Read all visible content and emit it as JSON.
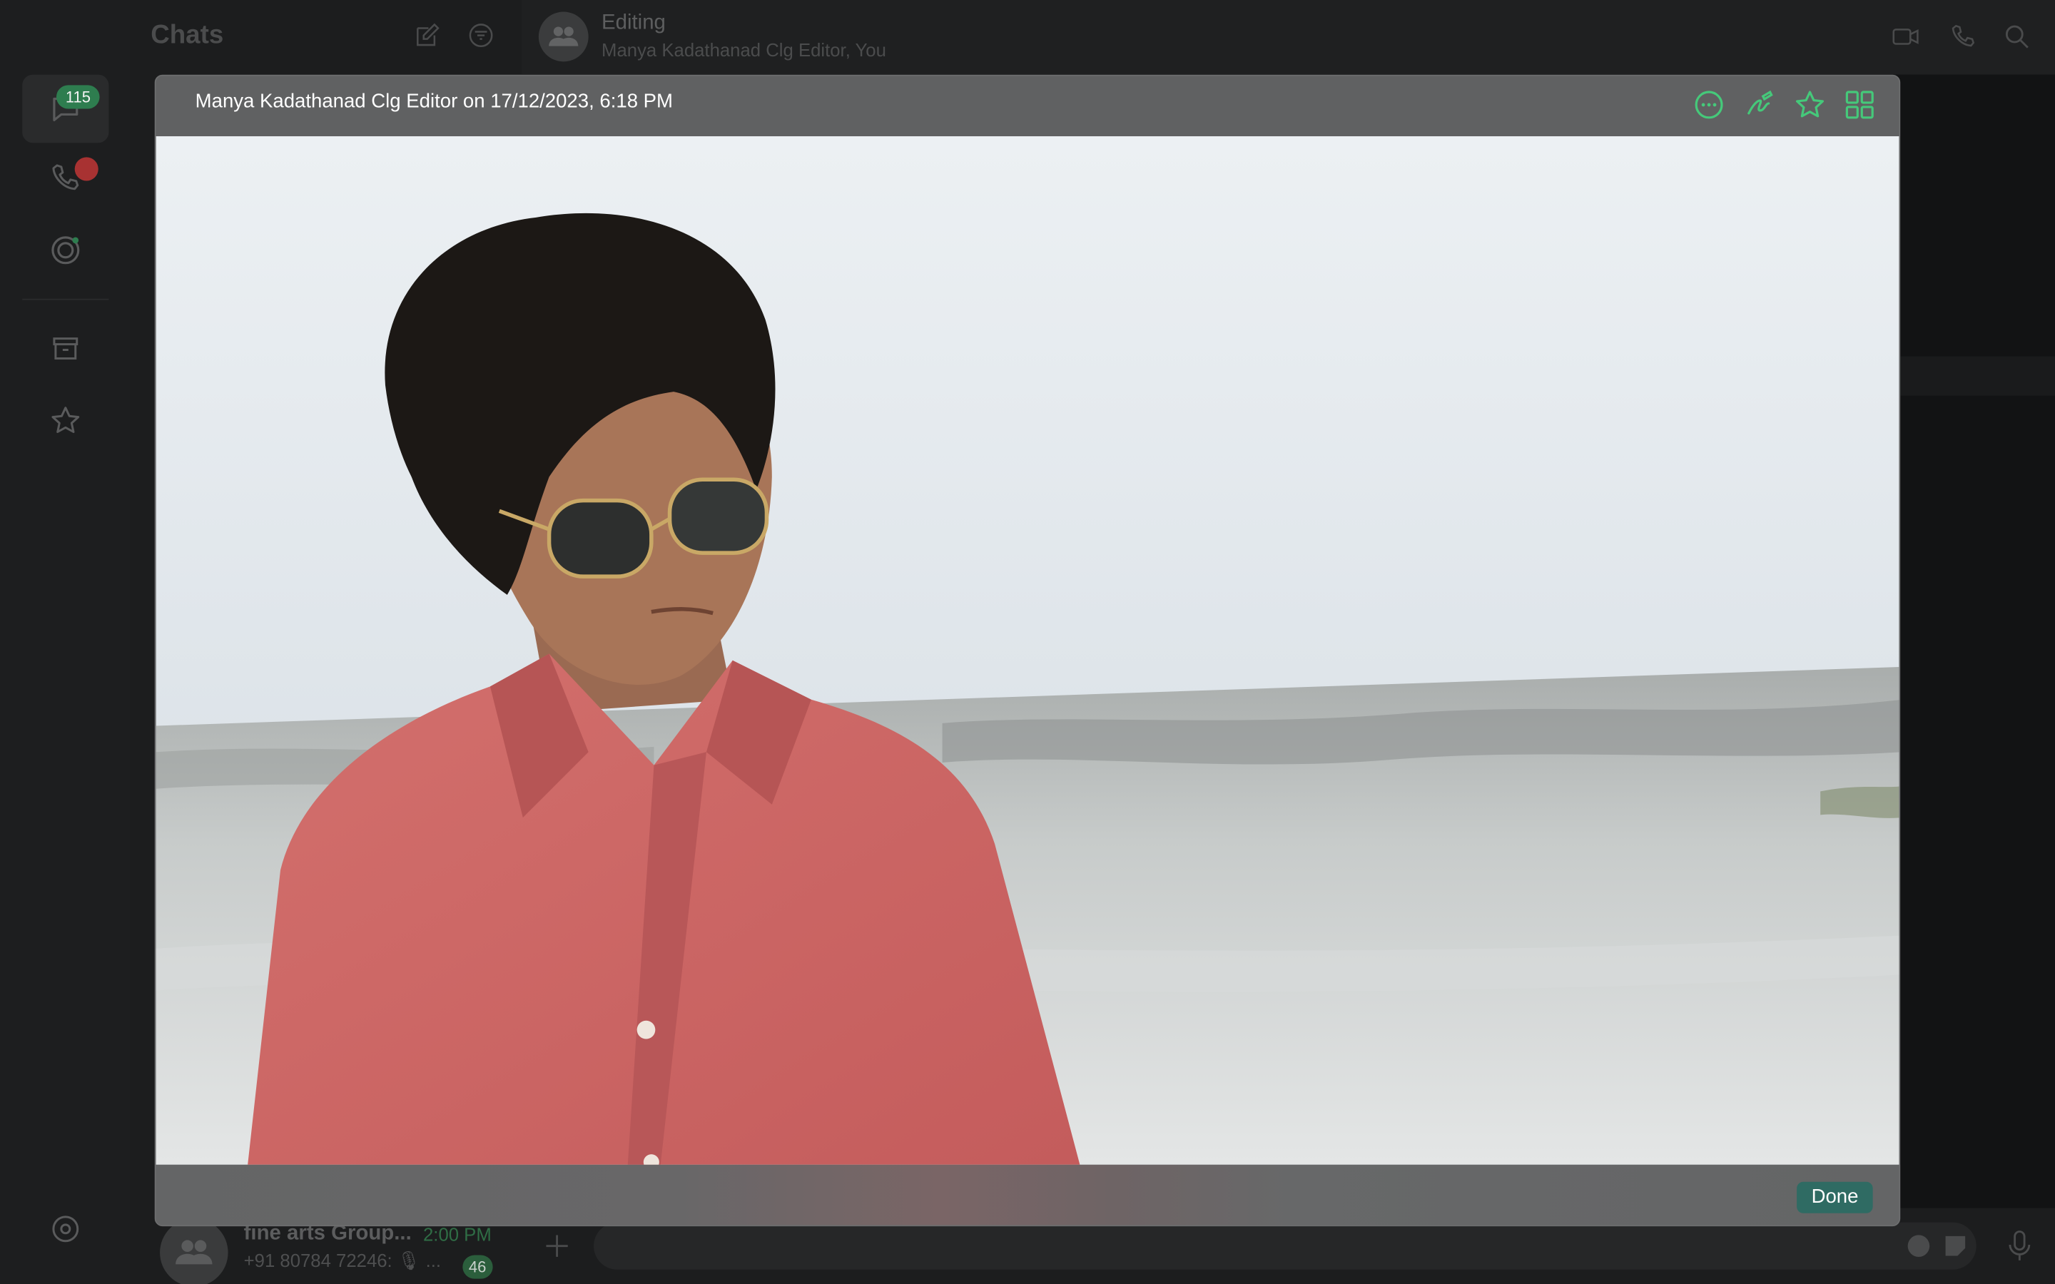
{
  "rail": {
    "chats_badge": "115",
    "items": [
      "chats",
      "calls",
      "status",
      "archived",
      "starred",
      "settings"
    ]
  },
  "chats": {
    "title": "Chats",
    "visible_row": {
      "name": "fine arts Group...",
      "time": "2:00 PM",
      "preview": "+91 80784 72246: 🎙 ...",
      "unread": "46"
    }
  },
  "conversation": {
    "title": "Editing",
    "subtitle": "Manya Kadathanad Clg Editor, You"
  },
  "viewer": {
    "caption": "Manya Kadathanad Clg Editor on 17/12/2023, 6:18 PM",
    "actions": [
      "more-options",
      "draw-edit",
      "star",
      "grid-view"
    ],
    "done_label": "Done"
  },
  "colors": {
    "accent": "#25d366",
    "viewer_icon": "#45c97a",
    "done_button": "#2f6b63",
    "badge_green": "#2e7d4f",
    "badge_red": "#c43a3a"
  }
}
